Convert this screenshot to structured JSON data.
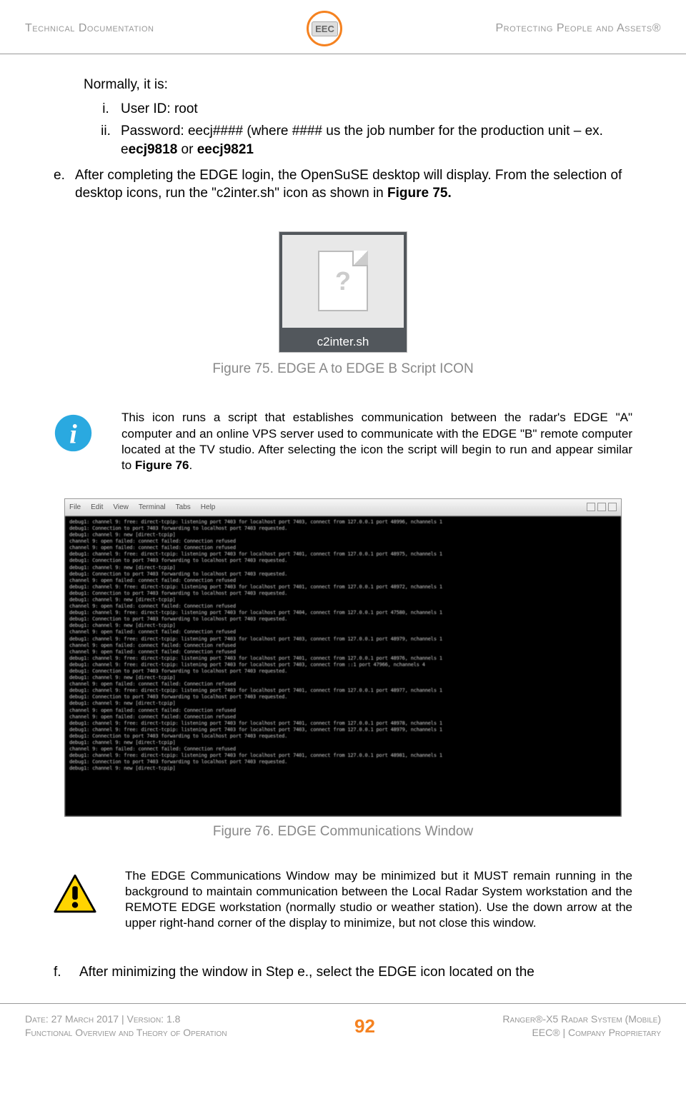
{
  "header": {
    "left": "Technical Documentation",
    "right": "Protecting People and Assets®",
    "logo_text": "EEC"
  },
  "body": {
    "intro": "Normally, it is:",
    "roman": {
      "i": {
        "marker": "i.",
        "text": "User ID: root"
      },
      "ii": {
        "marker": "ii.",
        "text_prefix": "Password: eecj#### (where #### us the job number for the production unit – ex. e",
        "bold1": "ecj9818",
        "mid": " or ",
        "bold2": "eecj9821"
      }
    },
    "e": {
      "marker": "e.",
      "text_prefix": "After completing the EDGE login, the OpenSuSE desktop will display.  From the selection of desktop icons, run the \"c2inter.sh\" icon as shown in ",
      "bold": "Figure 75."
    },
    "f": {
      "marker": "f.",
      "text": "After minimizing the window in Step e., select the EDGE icon located on the"
    }
  },
  "figure75": {
    "label": "c2inter.sh",
    "caption": "Figure 75. EDGE A to EDGE B Script ICON"
  },
  "info1": {
    "text_prefix": "This icon runs a script that establishes communication between the radar's EDGE \"A\" computer and an online VPS server used to communicate with the EDGE \"B\" remote computer located at the TV studio.  After selecting the icon the script will begin to run and appear similar to ",
    "bold": "Figure 76",
    "suffix": "."
  },
  "terminal": {
    "menu1": "File",
    "menu2": "Edit",
    "menu3": "View",
    "menu4": "Terminal",
    "menu5": "Tabs",
    "menu6": "Help",
    "lines": "debug1: channel 9: free: direct-tcpip: listening port 7403 for localhost port 7403, connect from 127.0.0.1 port 48996, nchannels 1\ndebug1: Connection to port 7403 forwarding to localhost port 7403 requested.\ndebug1: channel 9: new [direct-tcpip]\nchannel 9: open failed: connect failed: Connection refused\nchannel 9: open failed: connect failed: Connection refused\ndebug1: channel 9: free: direct-tcpip: listening port 7403 for localhost port 7401, connect from 127.0.0.1 port 48975, nchannels 1\ndebug1: Connection to port 7403 forwarding to localhost port 7403 requested.\ndebug1: channel 9: new [direct-tcpip]\ndebug1: Connection to port 7403 forwarding to localhost port 7403 requested.\nchannel 9: open failed: connect failed: Connection refused\ndebug1: channel 9: free: direct-tcpip: listening port 7403 for localhost port 7401, connect from 127.0.0.1 port 48972, nchannels 1\ndebug1: Connection to port 7403 forwarding to localhost port 7403 requested.\ndebug1: channel 9: new [direct-tcpip]\nchannel 9: open failed: connect failed: Connection refused\ndebug1: channel 9: free: direct-tcpip: listening port 7403 for localhost port 7404, connect from 127.0.0.1 port 47580, nchannels 1\ndebug1: Connection to port 7403 forwarding to localhost port 7403 requested.\ndebug1: channel 9: new [direct-tcpip]\nchannel 9: open failed: connect failed: Connection refused\ndebug1: channel 9: free: direct-tcpip: listening port 7403 for localhost port 7403, connect from 127.0.0.1 port 48979, nchannels 1\nchannel 9: open failed: connect failed: Connection refused\nchannel 9: open failed: connect failed: Connection refused\ndebug1: channel 9: free: direct-tcpip: listening port 7403 for localhost port 7401, connect from 127.0.0.1 port 48976, nchannels 1\ndebug1: channel 9: free: direct-tcpip: listening port 7403 for localhost port 7403, connect from ::1 port 47966, nchannels 4\ndebug1: Connection to port 7403 forwarding to localhost port 7403 requested.\ndebug1: channel 9: new [direct-tcpip]\nchannel 9: open failed: connect failed: Connection refused\ndebug1: channel 9: free: direct-tcpip: listening port 7403 for localhost port 7401, connect from 127.0.0.1 port 48977, nchannels 1\ndebug1: Connection to port 7403 forwarding to localhost port 7403 requested.\ndebug1: channel 9: new [direct-tcpip]\nchannel 9: open failed: connect failed: Connection refused\nchannel 9: open failed: connect failed: Connection refused\ndebug1: channel 9: free: direct-tcpip: listening port 7403 for localhost port 7401, connect from 127.0.0.1 port 48978, nchannels 1\ndebug1: channel 9: free: direct-tcpip: listening port 7403 for localhost port 7403, connect from 127.0.0.1 port 48979, nchannels 1\ndebug1: Connection to port 7403 forwarding to localhost port 7403 requested.\ndebug1: channel 9: new [direct-tcpip]\nchannel 9: open failed: connect failed: Connection refused\ndebug1: channel 9: free: direct-tcpip: listening port 7403 for localhost port 7401, connect from 127.0.0.1 port 48981, nchannels 1\ndebug1: Connection to port 7403 forwarding to localhost port 7403 requested.\ndebug1: channel 9: new [direct-tcpip]"
  },
  "figure76": {
    "caption": "Figure 76. EDGE Communications Window"
  },
  "warn": {
    "text": "The EDGE Communications Window may be minimized but it MUST remain running in the background to maintain communication between the Local Radar System workstation and the REMOTE EDGE workstation (normally studio or weather station).  Use the down arrow at the upper right-hand corner of the display to minimize, but not close this window."
  },
  "footer": {
    "left_line1": "Date: 27 March 2017 | Version: 1.8",
    "left_line2": "Functional Overview and Theory of Operation",
    "page": "92",
    "right_line1": "Ranger®-X5 Radar System (Mobile)",
    "right_line2": "EEC® | Company Proprietary"
  }
}
